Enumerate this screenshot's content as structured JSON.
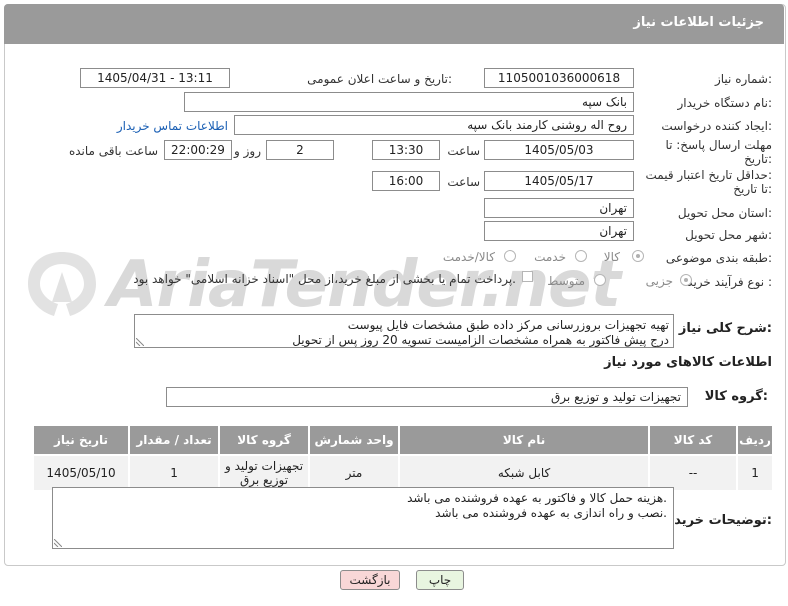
{
  "header": {
    "title": "جزئیات اطلاعات نیاز"
  },
  "form": {
    "need_number": {
      "label": "شماره نیاز:",
      "value": "1105001036000618"
    },
    "announce": {
      "label": "تاریخ و ساعت اعلان عمومی:",
      "value": "1405/04/31 - 13:11"
    },
    "buyer_org": {
      "label": "نام دستگاه خریدار:",
      "value": "بانک سپه"
    },
    "requester": {
      "label": "ایجاد کننده درخواست:",
      "value": "روح اله روشنی کارمند بانک سپه",
      "contact_link": "اطلاعات تماس خریدار"
    },
    "reply_deadline": {
      "label_line1": "مهلت ارسال پاسخ: تا",
      "label_line2": "تاریخ:",
      "date": "1405/05/03",
      "time_label": "ساعت",
      "time": "13:30",
      "days": "2",
      "days_label": "روز و",
      "remaining": "22:00:29",
      "remaining_label": "ساعت باقی مانده"
    },
    "price_validity": {
      "label_line1": "حداقل تاریخ اعتبار قیمت:",
      "label_line2": "تا تاریخ:",
      "date": "1405/05/17",
      "time_label": "ساعت",
      "time": "16:00"
    },
    "province": {
      "label": "استان محل تحویل:",
      "value": "تهران"
    },
    "city": {
      "label": "شهر محل تحویل:",
      "value": "تهران"
    },
    "category": {
      "label": "طبقه بندی موضوعی:",
      "options": [
        "کالا",
        "خدمت",
        "کالا/خدمت"
      ],
      "selected": "کالا"
    },
    "process": {
      "label": "نوع فرآیند خرید :",
      "options": [
        "جزیی",
        "متوسط"
      ],
      "selected": "جزیی",
      "payment_note": "پرداخت تمام یا بخشی از مبلغ خرید،از محل \"اسناد خزانه اسلامی\" خواهد بود."
    }
  },
  "description": {
    "label": "شرح کلی نیاز:",
    "lines": [
      "تهیه تجهیزات بروزرسانی مرکز داده طبق مشخصات فایل پیوست",
      "درج پیش فاکتور به همراه مشخصات الزامیست تسویه 20 روز پس از تحویل"
    ]
  },
  "goods": {
    "section_title": "اطلاعات کالاهای مورد نیاز",
    "group_label": "گروه کالا:",
    "group_value": "تجهیزات تولید و توزیع برق",
    "columns": [
      "ردیف",
      "کد کالا",
      "نام کالا",
      "واحد شمارش",
      "گروه کالا",
      "تعداد / مقدار",
      "تاریخ نیاز"
    ],
    "rows": [
      {
        "row": "1",
        "code": "--",
        "name": "کابل شبکه",
        "unit": "متر",
        "group_line1": "تجهیزات تولید و",
        "group_line2": "توزیع برق",
        "qty": "1",
        "date": "1405/05/10"
      }
    ]
  },
  "buyer_notes": {
    "label": "توضیحات خریدار:",
    "lines": [
      "هزینه حمل کالا و فاکتور به عهده فروشنده می باشد.",
      "نصب و راه اندازی به عهده فروشنده می باشد."
    ]
  },
  "buttons": {
    "print": "چاپ",
    "back": "بازگشت"
  },
  "watermark": {
    "text": "AriaTender.net"
  },
  "colors": {
    "header_bg": "#9a9a9a",
    "link": "#1a5fb4",
    "back_button_bg": "#f8d7d7",
    "print_button_bg": "#e8f5e0"
  }
}
